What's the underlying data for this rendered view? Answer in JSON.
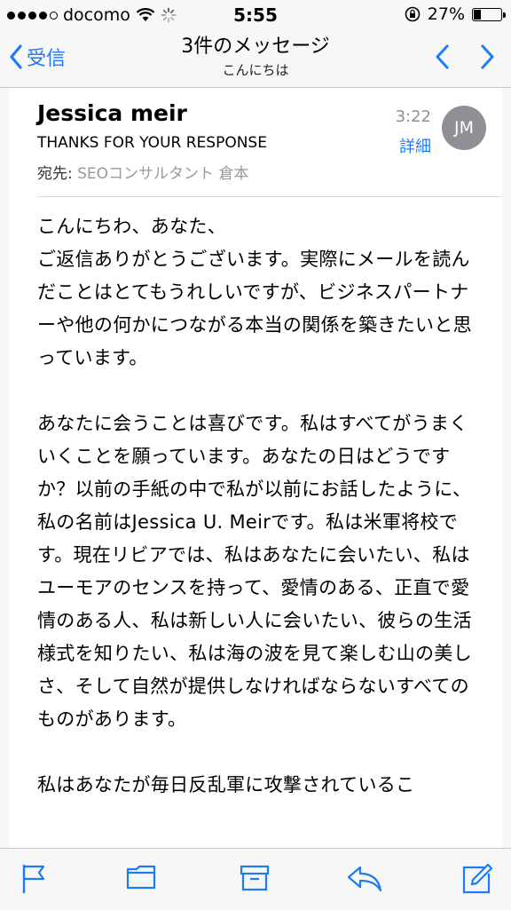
{
  "status_bar": {
    "carrier": "docomo",
    "time": "5:55",
    "battery_percent": "27%",
    "battery_level": 0.27
  },
  "nav": {
    "back_label": "受信",
    "title": "3件のメッセージ",
    "subtitle": "こんにちは"
  },
  "message": {
    "sender": "Jessica meir",
    "subject": "THANKS FOR YOUR RESPONSE",
    "to_label": "宛先:",
    "to_value": "SEOコンサルタント 倉本",
    "time": "3:22",
    "details_label": "詳細",
    "avatar_initials": "JM",
    "body": [
      "こんにちわ、あなた、\nご返信ありがとうございます。実際にメールを読んだことはとてもうれしいですが、ビジネスパートナーや他の何かにつながる本当の関係を築きたいと思っています。",
      "あなたに会うことは喜びです。私はすべてがうまくいくことを願っています。あなたの日はどうですか？以前の手紙の中で私が以前にお話したように、私の名前はJessica U. Meirです。私は米軍将校です。現在リビアでは、私はあなたに会いたい、私はユーモアのセンスを持って、愛情のある、正直で愛情のある人、私は新しい人に会いたい、彼らの生活様式を知りたい、私は海の波を見て楽しむ山の美しさ、そして自然が提供しなければならないすべてのものがあります。",
      "私はあなたが毎日反乱軍に攻撃されているこ"
    ]
  },
  "toolbar": {
    "icons": [
      "flag-icon",
      "folder-icon",
      "archive-icon",
      "reply-icon",
      "compose-icon"
    ]
  },
  "colors": {
    "accent": "#1e7cf2",
    "avatar_bg": "#8e9096",
    "bar_bg": "#f7f7f7"
  }
}
